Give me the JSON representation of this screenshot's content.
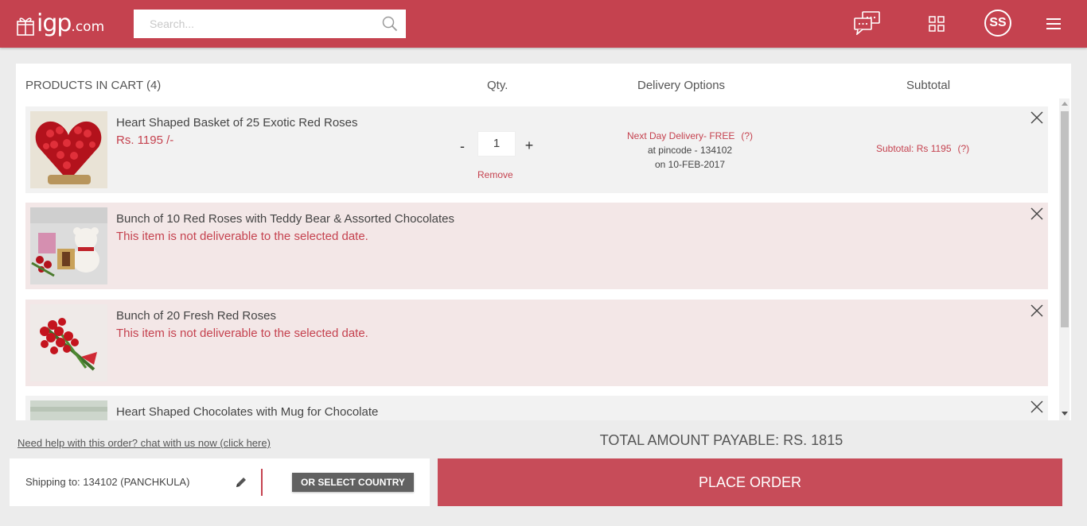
{
  "header": {
    "logo_text": "igp",
    "logo_tld": ".com",
    "search_placeholder": "Search...",
    "avatar_initials": "SS",
    "icons": [
      "gift-icon",
      "search-icon",
      "chat-icon",
      "grid-icon",
      "menu-icon"
    ]
  },
  "cart": {
    "headers": {
      "products": "PRODUCTS IN CART (4)",
      "qty": "Qty.",
      "delivery": "Delivery Options",
      "subtotal": "Subtotal"
    },
    "items": [
      {
        "name": "Heart Shaped Basket of 25 Exotic Red Roses",
        "price": "Rs. 1195 /-",
        "qty": "1",
        "qty_minus": "-",
        "qty_plus": "+",
        "remove": "Remove",
        "delivery_line1": "Next Day Delivery- FREE",
        "delivery_help": "(?)",
        "delivery_line2": "at pincode - 134102",
        "delivery_line3": "on 10-FEB-2017",
        "subtotal": "Subtotal: Rs 1195",
        "subtotal_help": "(?)"
      },
      {
        "name": "Bunch of 10 Red Roses with Teddy Bear & Assorted Chocolates",
        "warning": "This item is not deliverable to the selected date."
      },
      {
        "name": "Bunch of 20 Fresh Red Roses",
        "warning": "This item is not deliverable to the selected date."
      },
      {
        "name": "Heart Shaped Chocolates with Mug for Chocolate"
      }
    ]
  },
  "footer": {
    "help_link": "Need help with this order? chat with us now (click here)",
    "total": "TOTAL AMOUNT PAYABLE: RS. 1815",
    "shipping": "Shipping to: 134102 (PANCHKULA)",
    "country_button": "OR SELECT COUNTRY",
    "place_order": "PLACE ORDER"
  },
  "colors": {
    "brand": "#c5424f",
    "order_button": "#c74c59",
    "warning_row_bg": "#f3e7e7",
    "ok_row_bg": "#f2f2f2"
  }
}
